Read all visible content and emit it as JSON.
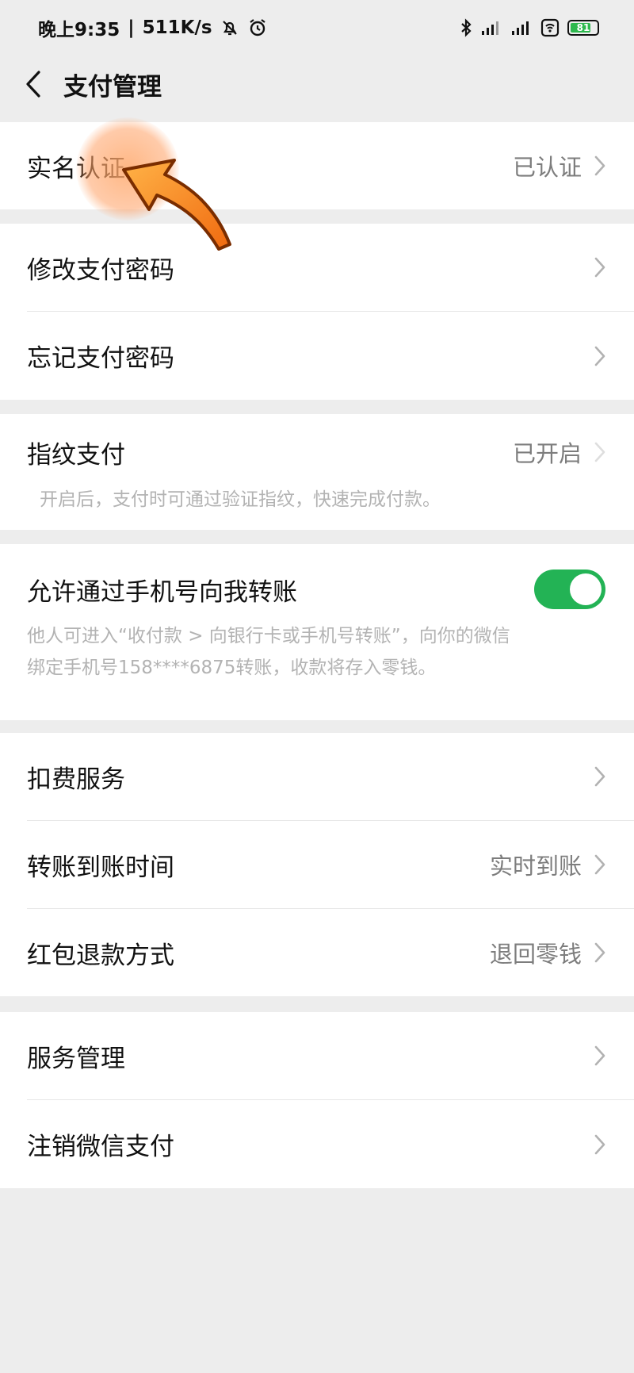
{
  "status_bar": {
    "time": "晚上9:35",
    "net_speed": "511K/s",
    "battery_level": "81",
    "icons": [
      "mute-bell-icon",
      "alarm-icon",
      "bluetooth-icon",
      "signal-4g-icon",
      "signal-icon",
      "wifi-icon",
      "battery-icon"
    ]
  },
  "header": {
    "title": "支付管理",
    "back_icon": "chevron-left-icon"
  },
  "sections": {
    "realname": {
      "label": "实名认证",
      "value": "已认证"
    },
    "change_pwd": {
      "label": "修改支付密码"
    },
    "forgot_pwd": {
      "label": "忘记支付密码"
    },
    "fingerprint": {
      "label": "指纹支付",
      "value": "已开启",
      "desc": "开启后，支付时可通过验证指纹，快速完成付款。"
    },
    "phone_transfer": {
      "label": "允许通过手机号向我转账",
      "enabled": true,
      "desc_line1": "他人可进入“收付款 > 向银行卡或手机号转账”，向你的微信",
      "desc_line2": "绑定手机号158****6875转账，收款将存入零钱。"
    },
    "deduct": {
      "label": "扣费服务"
    },
    "transfer_time": {
      "label": "转账到账时间",
      "value": "实时到账"
    },
    "redpacket_refund": {
      "label": "红包退款方式",
      "value": "退回零钱"
    },
    "service_mgmt": {
      "label": "服务管理"
    },
    "cancel_pay": {
      "label": "注销微信支付"
    }
  },
  "colors": {
    "accent_green": "#23b355",
    "background": "#ededed",
    "highlight_orange": "#ff8a2a"
  }
}
